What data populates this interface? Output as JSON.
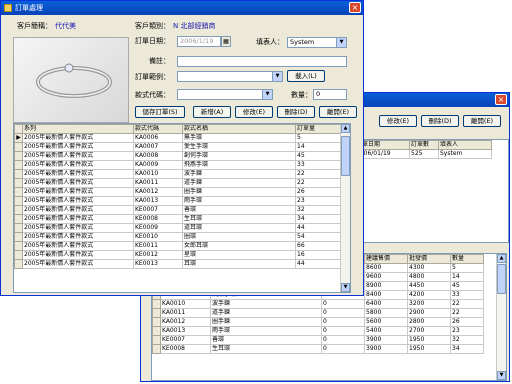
{
  "back_window": {
    "toolbar": {
      "modify": "修改(E)",
      "delete": "刪除(D)",
      "leave": "離開(E)"
    },
    "order_grid": {
      "headers": [
        "訂單日期",
        "訂單數",
        "填表人"
      ],
      "rows": [
        [
          "2006/01/19",
          "525",
          "System"
        ]
      ]
    },
    "detail_grid": {
      "headers": [
        "建議售價",
        "批發價",
        "數量"
      ],
      "top_rows": [
        [
          "8600",
          "4300",
          "5"
        ],
        [
          "9600",
          "4800",
          "14"
        ],
        [
          "8900",
          "4450",
          "45"
        ]
      ],
      "rows": [
        {
          "code": "KA0009",
          "name": "飛燕手環",
          "qty": "0",
          "price": "8400",
          "wholesale": "4200",
          "num": "33"
        },
        {
          "code": "KA0010",
          "name": "波手鍊",
          "qty": "0",
          "price": "6400",
          "wholesale": "3200",
          "num": "22"
        },
        {
          "code": "KA0011",
          "name": "道手鍊",
          "qty": "0",
          "price": "5800",
          "qty2": "",
          "wholesale": "2900",
          "num": "22"
        },
        {
          "code": "KA0012",
          "name": "圈手鍊",
          "qty": "0",
          "price": "5600",
          "wholesale": "2800",
          "num": "26"
        },
        {
          "code": "KA0013",
          "name": "雨手環",
          "qty": "0",
          "price": "5400",
          "wholesale": "2700",
          "num": "23"
        },
        {
          "code": "KE0007",
          "name": "善環",
          "qty": "0",
          "price": "3900",
          "wholesale": "1950",
          "num": "32"
        },
        {
          "code": "KE0008",
          "name": "生耳環",
          "qty": "0",
          "price": "3900",
          "wholesale": "1950",
          "num": "34"
        }
      ]
    }
  },
  "front_window": {
    "title": "訂單處理",
    "close": "×",
    "customer_label": "客戶簡稱：",
    "customer_value": "代代美",
    "category_label": "客戶類別：",
    "category_value": "N 北部經銷商",
    "order_date_label": "訂單日期：",
    "order_date_value": "2006/1/19",
    "filler_label": "填表人：",
    "filler_value": "System",
    "note_label": "備註：",
    "note_value": "",
    "range_label": "訂單範例：",
    "range_value": "",
    "load_button": "載入(L)",
    "style_label": "款式代碼：",
    "style_value": "",
    "qty_label": "數量：",
    "qty_value": "0",
    "buttons": {
      "save": "儲存訂單(S)",
      "add": "新增(A)",
      "edit": "修改(E)",
      "delete": "刪除(D)",
      "leave": "離開(E)"
    },
    "grid": {
      "headers": [
        "系列",
        "款式代碼",
        "款式名稱",
        "訂單量"
      ],
      "rows": [
        [
          "2005年最新情人套件款式",
          "KA0006",
          "無手環",
          "5"
        ],
        [
          "2005年最新情人套件款式",
          "KA0007",
          "愛生手環",
          "14"
        ],
        [
          "2005年最新情人套件款式",
          "KA0008",
          "創何手環",
          "45"
        ],
        [
          "2005年最新情人套件款式",
          "KA0009",
          "飛燕手環",
          "33"
        ],
        [
          "2005年最新情人套件款式",
          "KA0010",
          "波手鍊",
          "22"
        ],
        [
          "2005年最新情人套件款式",
          "KA0011",
          "道手鍊",
          "22"
        ],
        [
          "2005年最新情人套件款式",
          "KA0012",
          "圈手鍊",
          "26"
        ],
        [
          "2005年最新情人套件款式",
          "KA0013",
          "雨手環",
          "23"
        ],
        [
          "2005年最新情人套件款式",
          "KE0007",
          "善環",
          "32"
        ],
        [
          "2005年最新情人套件款式",
          "KE0008",
          "生耳環",
          "34"
        ],
        [
          "2005年最新情人套件款式",
          "KE0009",
          "道耳環",
          "44"
        ],
        [
          "2005年最新情人套件款式",
          "KE0010",
          "圈環",
          "54"
        ],
        [
          "2005年最新情人套件款式",
          "KE0011",
          "女郎耳環",
          "66"
        ],
        [
          "2005年最新情人套件款式",
          "KE0012",
          "星環",
          "16"
        ],
        [
          "2005年最新情人套件款式",
          "KE0013",
          "耳環",
          "44"
        ]
      ]
    }
  }
}
